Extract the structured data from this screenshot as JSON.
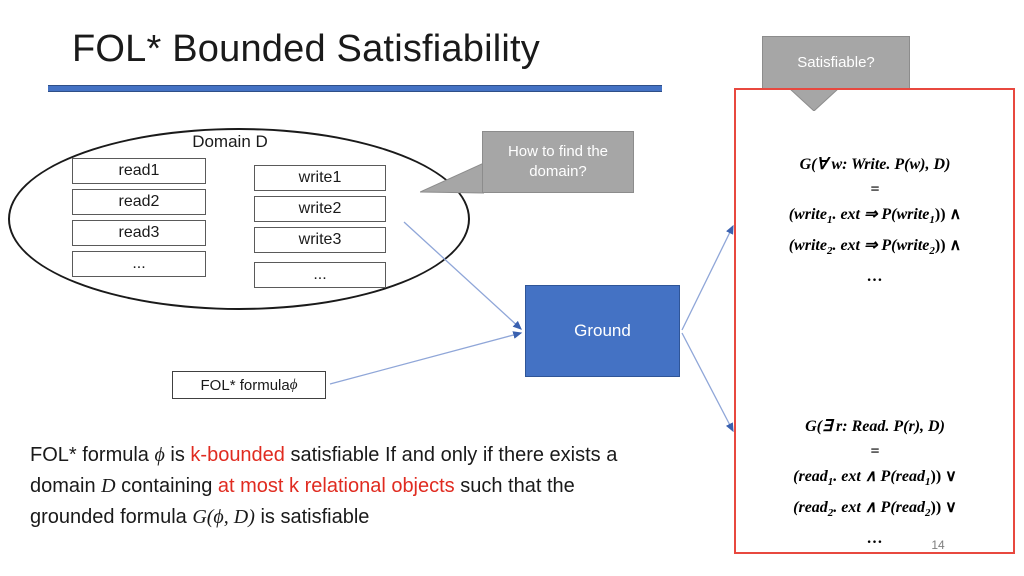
{
  "slide": {
    "title": "FOL* Bounded Satisfiability",
    "number": "14",
    "accent_blue": "#4472c4",
    "accent_red": "#e8483f",
    "callout_gray": "#a6a6a6",
    "highlight_red": "#e02b20"
  },
  "domain": {
    "label": "Domain D",
    "read_objects": [
      "read1",
      "read2",
      "read3",
      "..."
    ],
    "write_objects": [
      "write1",
      "write2",
      "write3",
      "..."
    ]
  },
  "callouts": {
    "domain_question": "How to find the domain?",
    "satisfiable_question": "Satisfiable?"
  },
  "ground": {
    "label": "Ground"
  },
  "input": {
    "fol_formula_label_prefix": "FOL* formula ",
    "fol_formula_symbol": "ϕ"
  },
  "formulas": {
    "top": {
      "line1": "G(∀ w: Write. P(w), D)",
      "line2": "=",
      "line3_a": "(write",
      "line3_sub": "1",
      "line3_b": ". ext ⇒ P(write",
      "line3_sub2": "1",
      "line3_c": ")) ∧",
      "line4_a": "(write",
      "line4_sub": "2",
      "line4_b": ". ext ⇒ P(write",
      "line4_sub2": "2",
      "line4_c": ")) ∧",
      "line5": "…"
    },
    "bottom": {
      "line1": "G(∃ r: Read. P(r), D)",
      "line2": "=",
      "line3_a": "(read",
      "line3_sub": "1",
      "line3_b": ". ext ∧ P(read",
      "line3_sub2": "1",
      "line3_c": ")) ∨",
      "line4_a": "(read",
      "line4_sub": "2",
      "line4_b": ". ext ∧ P(read",
      "line4_sub2": "2",
      "line4_c": ")) ∨",
      "line5": "…"
    }
  },
  "body": {
    "seg1": "FOL* formula ",
    "phi1": "ϕ",
    "seg2": " is ",
    "hl1": "k-bounded",
    "seg3": " satisfiable If and only if there exists a domain ",
    "var_d": "D",
    "seg4": " containing ",
    "hl2": "at most k relational objects",
    "seg5": " such that the grounded formula ",
    "grounded": "G(ϕ, D)",
    "seg6": " is satisfiable"
  }
}
